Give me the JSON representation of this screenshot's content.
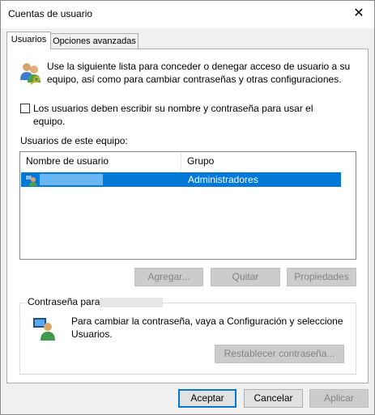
{
  "window": {
    "title": "Cuentas de usuario"
  },
  "tabs": [
    {
      "label": "Usuarios",
      "active": true
    },
    {
      "label": "Opciones avanzadas",
      "active": false
    }
  ],
  "intro_text": "Use la siguiente lista para conceder o denegar acceso de usuario a su equipo, así como para cambiar contraseñas y otras configuraciones.",
  "require_login": {
    "label": "Los usuarios deben escribir su nombre y contraseña para usar el equipo.",
    "checked": false
  },
  "users_section_label": "Usuarios de este equipo:",
  "users_table": {
    "columns": [
      "Nombre de usuario",
      "Grupo"
    ],
    "rows": [
      {
        "name": "",
        "group": "Administradores",
        "selected": true
      }
    ]
  },
  "user_buttons": {
    "add": "Agregar...",
    "remove": "Quitar",
    "properties": "Propiedades"
  },
  "password_group": {
    "label": "Contraseña para",
    "text": "Para cambiar la contraseña, vaya a Configuración y seleccione Usuarios.",
    "reset_button": "Restablecer contraseña..."
  },
  "dialog_buttons": {
    "ok": "Aceptar",
    "cancel": "Cancelar",
    "apply": "Aplicar"
  },
  "colors": {
    "selection": "#0078d7",
    "window_bg": "#f0f0f0",
    "disabled_text": "#838383"
  },
  "icons": [
    "close-icon",
    "users-key-icon",
    "user-icon",
    "user-monitor-icon"
  ]
}
